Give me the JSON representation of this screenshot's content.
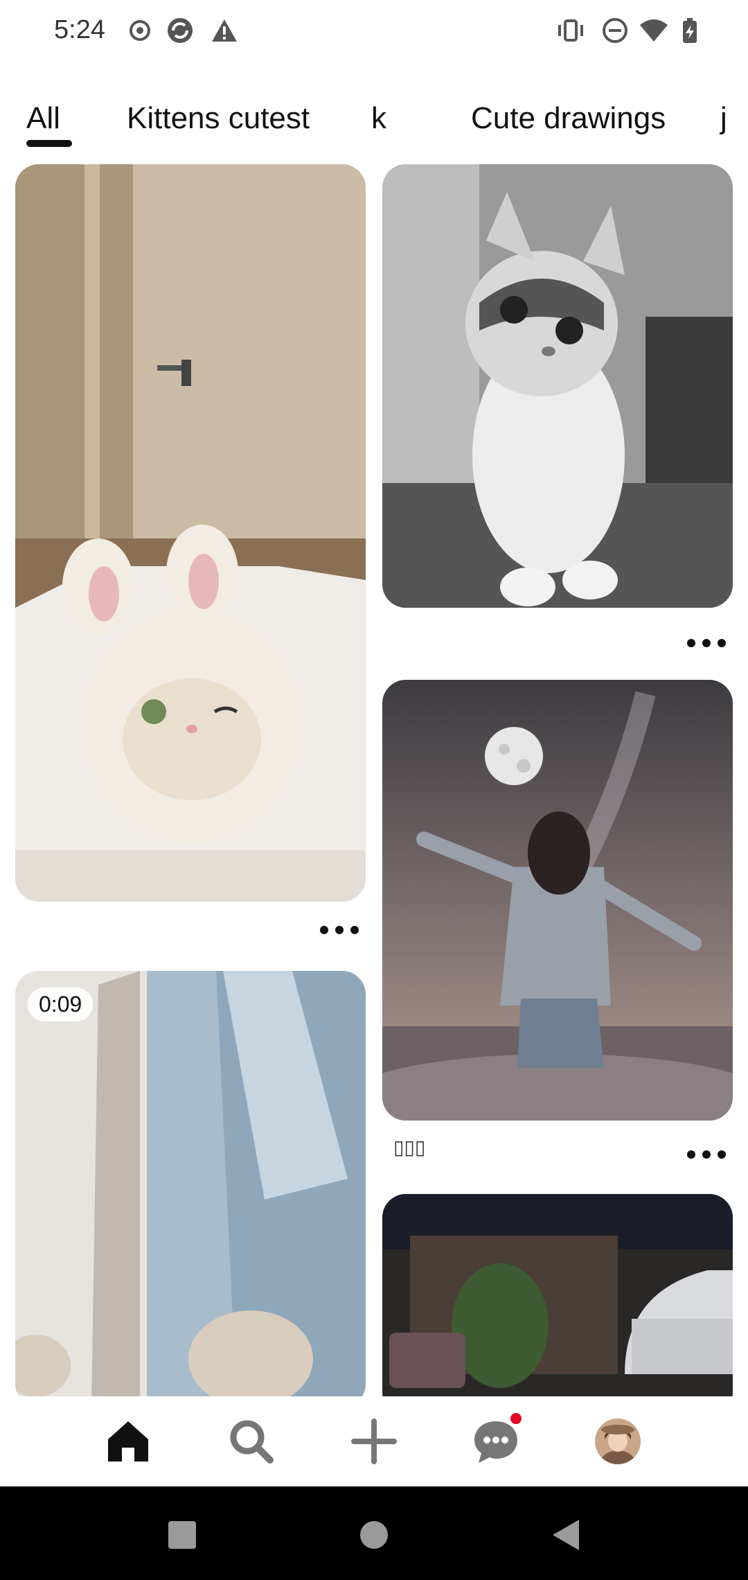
{
  "status_bar": {
    "time": "5:24",
    "left_icons": [
      "record-icon",
      "sync-app-icon",
      "warning-icon"
    ],
    "right_icons": [
      "vibrate-icon",
      "do-not-disturb-icon",
      "wifi-icon",
      "battery-icon"
    ]
  },
  "tabs": [
    {
      "label": "All",
      "selected": true
    },
    {
      "label": "Kittens cutest",
      "selected": false
    },
    {
      "label": "k",
      "selected": false
    },
    {
      "label": "Cute drawings",
      "selected": false
    },
    {
      "label": "j",
      "selected": false
    }
  ],
  "feed": {
    "pins": [
      {
        "name": "pin-bunny-hat-kitten",
        "title": ""
      },
      {
        "name": "pin-gray-kitten",
        "title": ""
      },
      {
        "name": "pin-moon-girl",
        "title": "▯▯▯"
      },
      {
        "name": "pin-video-water-channel",
        "title": "",
        "duration": "0:09"
      },
      {
        "name": "pin-night-street",
        "title": ""
      }
    ]
  },
  "bottom_nav": {
    "items": [
      "home-icon",
      "search-icon",
      "create-icon",
      "messages-icon",
      "profile-avatar"
    ],
    "active": "home-icon"
  },
  "colors": {
    "accent": "#e60023",
    "text": "#111111",
    "background": "#ffffff"
  }
}
